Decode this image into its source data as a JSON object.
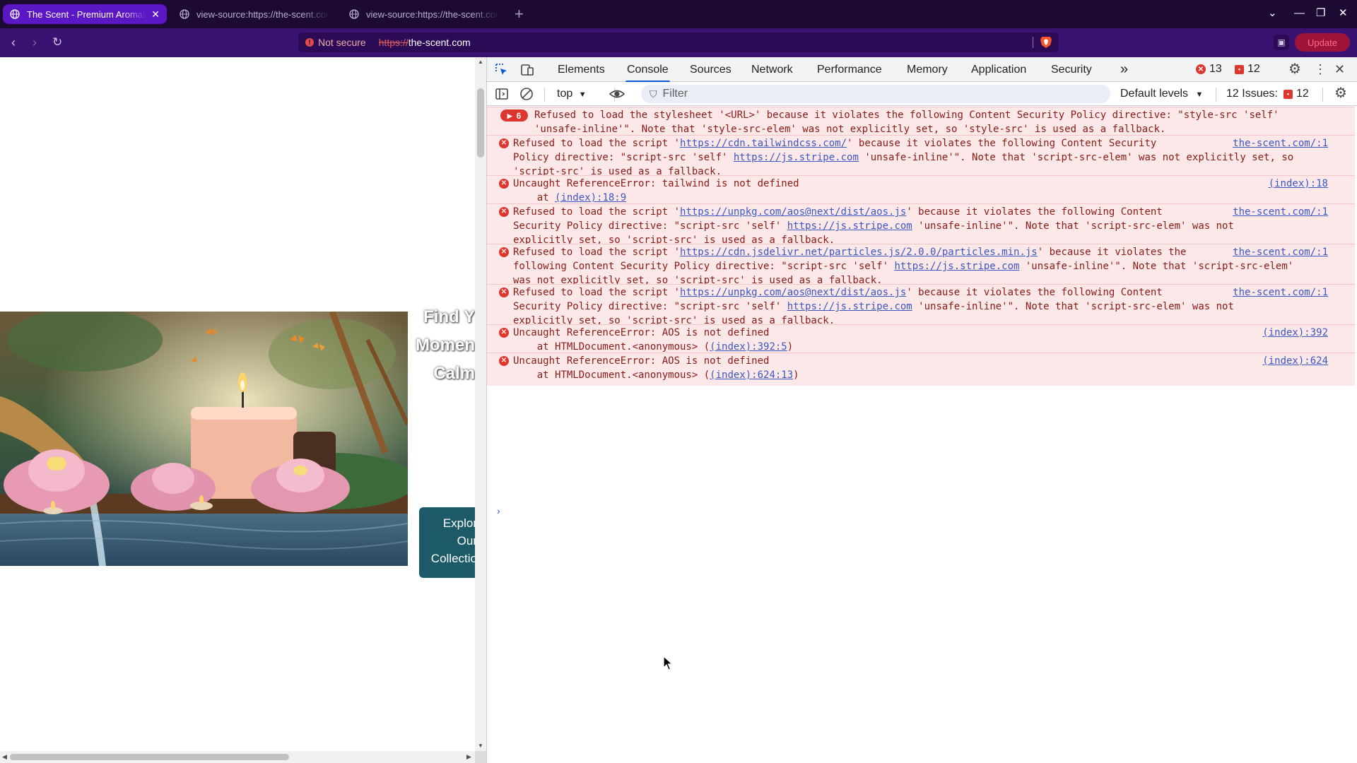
{
  "browser": {
    "tabs": [
      {
        "title": "The Scent - Premium Aromatherapy",
        "active": true
      },
      {
        "title": "view-source:https://the-scent.com",
        "active": false
      },
      {
        "title": "view-source:https://the-scent.com",
        "active": false
      }
    ],
    "new_tab": "+",
    "security_label": "Not secure",
    "url_scheme": "https://",
    "url_host": "the-scent.com",
    "update_label": "Update",
    "colors": {
      "chrome": "#1c0a33",
      "toolbar": "#3a1272",
      "active_tab": "#5b17c4"
    }
  },
  "page": {
    "hero_lines": [
      "Find Y",
      "Momen",
      "Calm"
    ],
    "cta_lines": [
      "Explor",
      "Our",
      "Collectio"
    ]
  },
  "devtools": {
    "tabs": [
      "Elements",
      "Console",
      "Sources",
      "Network",
      "Performance",
      "Memory",
      "Application",
      "Security"
    ],
    "active_tab": "Console",
    "more_tabs": "»",
    "error_count": "13",
    "issue_count": "12",
    "context": "top",
    "filter_placeholder": "Filter",
    "levels": "Default levels",
    "issues_label": "12 Issues:",
    "issues_badge": "12"
  },
  "console": {
    "group_count": "6",
    "messages": [
      {
        "lines": [
          [
            "Refused to load the stylesheet '<URL>' because it violates the following Content Security Policy directive: \"style-src 'self'"
          ],
          [
            "'unsafe-inline'\". Note that 'style-src-elem' was not explicitly set, so 'style-src' is used as a fallback."
          ]
        ],
        "source": ""
      },
      {
        "lines": [
          [
            "Refused to load the script '",
            {
              "link": "https://cdn.tailwindcss.com/"
            },
            "' because it violates the following Content Security"
          ],
          [
            "Policy directive: \"script-src 'self' ",
            {
              "link": "https://js.stripe.com"
            },
            " 'unsafe-inline'\". Note that 'script-src-elem' was not explicitly set, so"
          ],
          [
            "'script-src' is used as a fallback."
          ]
        ],
        "source": "the-scent.com/:1"
      },
      {
        "lines": [
          [
            "Uncaught ReferenceError: tailwind is not defined"
          ],
          [
            "    at ",
            {
              "link": "(index):18:9"
            }
          ]
        ],
        "source": "(index):18"
      },
      {
        "lines": [
          [
            "Refused to load the script '",
            {
              "link": "https://unpkg.com/aos@next/dist/aos.js"
            },
            "' because it violates the following Content"
          ],
          [
            "Security Policy directive: \"script-src 'self' ",
            {
              "link": "https://js.stripe.com"
            },
            " 'unsafe-inline'\". Note that 'script-src-elem' was not"
          ],
          [
            "explicitly set, so 'script-src' is used as a fallback."
          ]
        ],
        "source": "the-scent.com/:1"
      },
      {
        "lines": [
          [
            "Refused to load the script '",
            {
              "link": "https://cdn.jsdelivr.net/particles.js/2.0.0/particles.min.js"
            },
            "' because it violates the"
          ],
          [
            "following Content Security Policy directive: \"script-src 'self' ",
            {
              "link": "https://js.stripe.com"
            },
            " 'unsafe-inline'\". Note that 'script-src-elem'"
          ],
          [
            "was not explicitly set, so 'script-src' is used as a fallback."
          ]
        ],
        "source": "the-scent.com/:1"
      },
      {
        "lines": [
          [
            "Refused to load the script '",
            {
              "link": "https://unpkg.com/aos@next/dist/aos.js"
            },
            "' because it violates the following Content"
          ],
          [
            "Security Policy directive: \"script-src 'self' ",
            {
              "link": "https://js.stripe.com"
            },
            " 'unsafe-inline'\". Note that 'script-src-elem' was not"
          ],
          [
            "explicitly set, so 'script-src' is used as a fallback."
          ]
        ],
        "source": "the-scent.com/:1"
      },
      {
        "lines": [
          [
            "Uncaught ReferenceError: AOS is not defined"
          ],
          [
            "    at HTMLDocument.<anonymous> (",
            {
              "link": "(index):392:5"
            },
            ")"
          ]
        ],
        "source": "(index):392"
      },
      {
        "lines": [
          [
            "Uncaught ReferenceError: AOS is not defined"
          ],
          [
            "    at HTMLDocument.<anonymous> (",
            {
              "link": "(index):624:13"
            },
            ")"
          ]
        ],
        "source": "(index):624"
      }
    ]
  }
}
